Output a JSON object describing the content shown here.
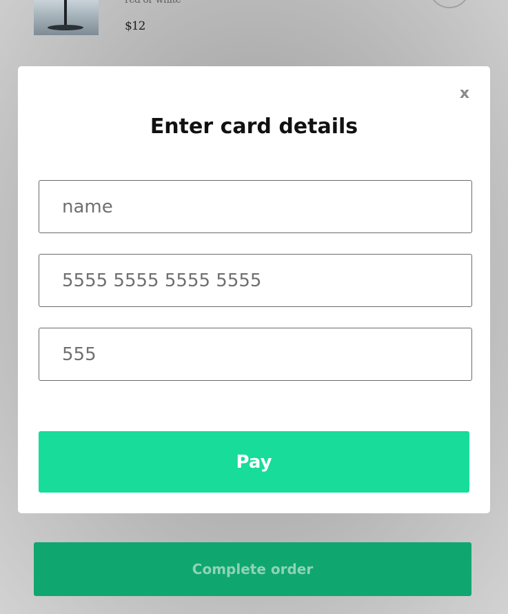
{
  "background": {
    "product": {
      "variant": "red or white",
      "price": "$12"
    },
    "complete_order_label": "Complete order"
  },
  "modal": {
    "close_label": "x",
    "title": "Enter card details",
    "fields": {
      "name_placeholder": "name",
      "card_number_placeholder": "5555 5555 5555 5555",
      "cvc_placeholder": "555"
    },
    "pay_label": "Pay"
  },
  "colors": {
    "accent": "#17dc9a",
    "complete_order_bg": "#10a670",
    "overlay": "#b0b0b0"
  }
}
